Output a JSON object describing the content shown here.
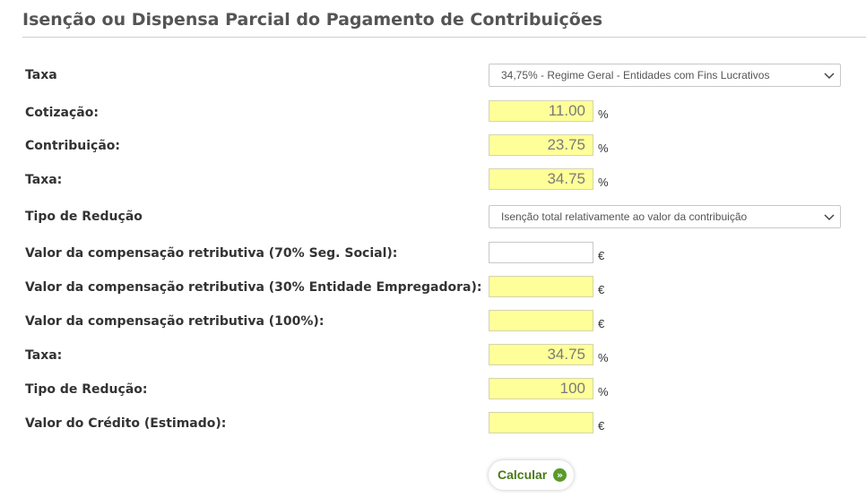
{
  "page": {
    "title": "Isenção ou Dispensa Parcial do Pagamento de Contribuições"
  },
  "form": {
    "taxa_select": {
      "label": "Taxa",
      "value": "34,75% - Regime Geral - Entidades com Fins Lucrativos"
    },
    "cotizacao": {
      "label": "Cotização:",
      "value": "11.00",
      "unit": "%"
    },
    "contribuicao": {
      "label": "Contribuição:",
      "value": "23.75",
      "unit": "%"
    },
    "taxa_total": {
      "label": "Taxa:",
      "value": "34.75",
      "unit": "%"
    },
    "tipo_reducao_select": {
      "label": "Tipo de Redução",
      "value": "Isenção total relativamente ao valor da contribuição"
    },
    "comp_70": {
      "label": "Valor da compensação retributiva (70% Seg. Social):",
      "value": "",
      "unit": "€"
    },
    "comp_30": {
      "label": "Valor da compensação retributiva (30% Entidade Empregadora):",
      "value": "",
      "unit": "€"
    },
    "comp_100": {
      "label": "Valor da compensação retributiva (100%):",
      "value": "",
      "unit": "€"
    },
    "taxa_result": {
      "label": "Taxa:",
      "value": "34.75",
      "unit": "%"
    },
    "tipo_reducao_result": {
      "label": "Tipo de Redução:",
      "value": "100",
      "unit": "%"
    },
    "credito": {
      "label": "Valor do Crédito (Estimado):",
      "value": "",
      "unit": "€"
    }
  },
  "actions": {
    "calcular_label": "Calcular",
    "calcular_icon": "double-chevron-right-icon"
  },
  "colors": {
    "highlight_field": "#ffff99",
    "button_text": "#4a7a1a",
    "button_icon": "#5a9a2a"
  }
}
